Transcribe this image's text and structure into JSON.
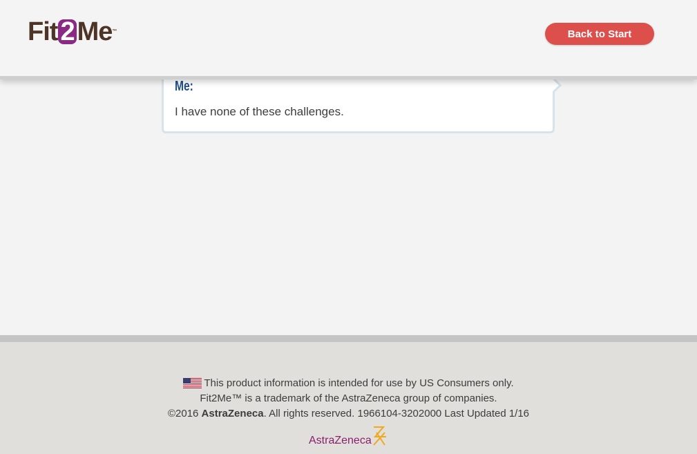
{
  "header": {
    "logo": {
      "part1": "Fit",
      "part2": "2",
      "part3": "Me",
      "tm": "™"
    },
    "back_button_label": "Back to Start"
  },
  "chat": {
    "speaker": "Me:",
    "message": "I have none of these challenges."
  },
  "footer": {
    "flag_icon": "us-flag-icon",
    "line1": "This product information is intended for use by US Consumers only.",
    "line2": "Fit2Me™ is a trademark of the AstraZeneca group of companies.",
    "line3_prefix": "©2016 ",
    "line3_brand": "AstraZeneca",
    "line3_suffix": ". All rights reserved. 1966104-3202000 Last Updated 1/16",
    "az_logo_text": "AstraZeneca"
  },
  "colors": {
    "brand_brown": "#4e3427",
    "brand_purple": "#8a2a84",
    "button_red": "#dc4f4b",
    "speaker_blue": "#1f4f8a",
    "az_magenta": "#8a1f6c",
    "az_gold": "#f0a81e"
  }
}
